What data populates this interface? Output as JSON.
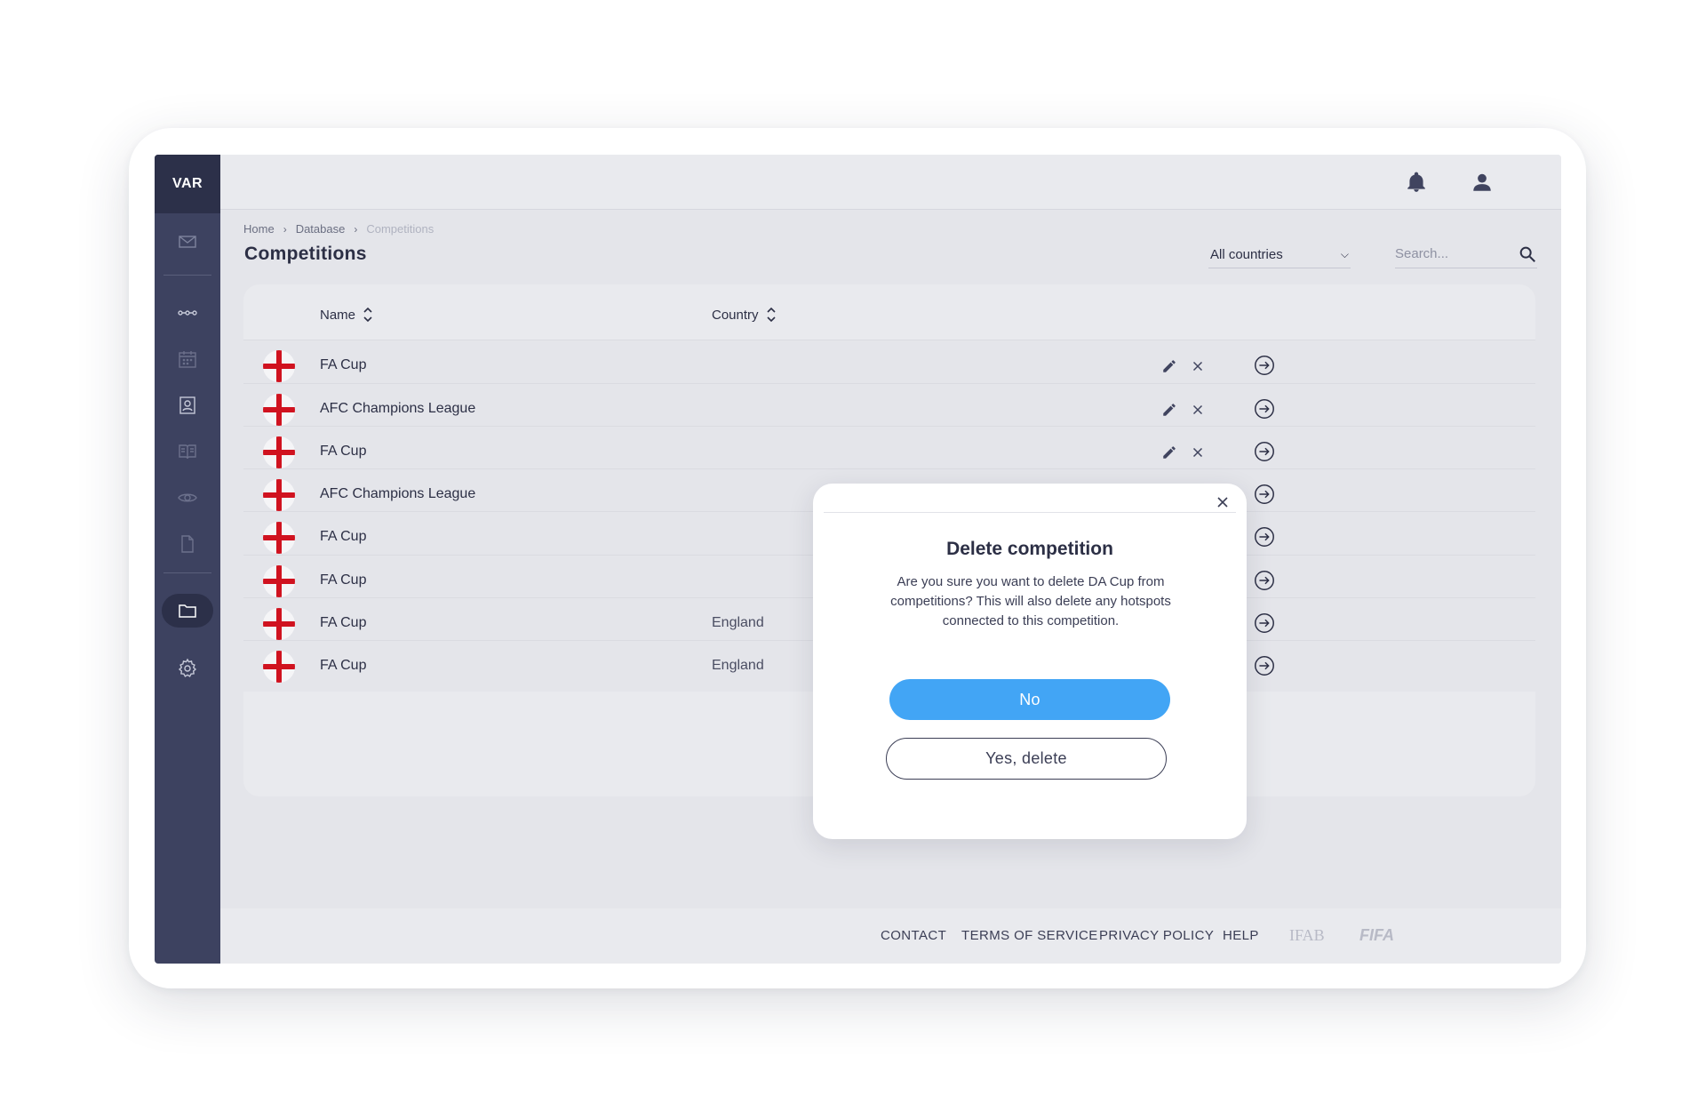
{
  "app": {
    "logo": "VAR"
  },
  "sidebar": {
    "items": [
      {
        "icon": "mail-icon"
      },
      {
        "icon": "timeline-icon"
      },
      {
        "icon": "calendar-icon"
      },
      {
        "icon": "contacts-icon"
      },
      {
        "icon": "book-icon"
      },
      {
        "icon": "eye-icon"
      },
      {
        "icon": "document-icon"
      },
      {
        "icon": "folder-icon",
        "active": true
      },
      {
        "icon": "gear-icon"
      }
    ]
  },
  "header": {
    "icons": [
      "bell-icon",
      "user-icon"
    ]
  },
  "breadcrumb": {
    "items": [
      "Home",
      "Database",
      "Competitions"
    ]
  },
  "page": {
    "title": "Competitions"
  },
  "filters": {
    "country_select": "All countries",
    "search_placeholder": "Search..."
  },
  "table": {
    "columns": [
      "Name",
      "Country"
    ],
    "rows": [
      {
        "name": "FA Cup",
        "country": ""
      },
      {
        "name": "AFC Champions League",
        "country": ""
      },
      {
        "name": "FA Cup",
        "country": ""
      },
      {
        "name": "AFC Champions League",
        "country": ""
      },
      {
        "name": "FA Cup",
        "country": ""
      },
      {
        "name": "FA Cup",
        "country": ""
      },
      {
        "name": "FA Cup",
        "country": "England"
      },
      {
        "name": "FA Cup",
        "country": "England"
      }
    ]
  },
  "modal": {
    "title": "Delete competition",
    "body": "Are you sure you want to delete DA Cup from competitions? This will also delete any hotspots connected to this competition.",
    "no_label": "No",
    "yes_label": "Yes, delete"
  },
  "footer": {
    "links": [
      "CONTACT",
      "TERMS OF SERVICE",
      "PRIVACY POLICY",
      "HELP"
    ],
    "logos": [
      "IFAB",
      "FIFA"
    ]
  },
  "colors": {
    "sidebar": "#3d4260",
    "accent_blue": "#42a5f5",
    "flag_red": "#d0121f"
  }
}
